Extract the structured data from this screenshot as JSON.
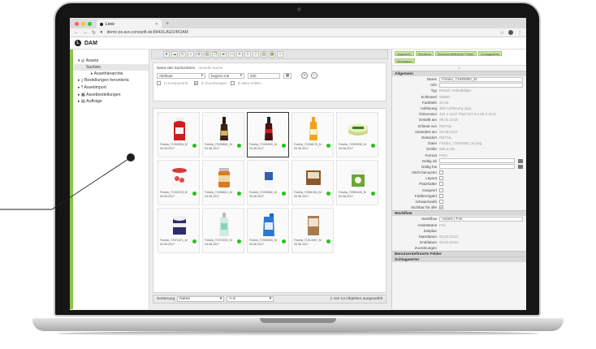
{
  "browser": {
    "tab_title": "Lexo",
    "url": "demo-px.avx.conosoft.de:8443/LAGO/ROAM",
    "window_dot_colors": [
      "#ff5f57",
      "#febc2e",
      "#28c840"
    ]
  },
  "app": {
    "title": "DAM"
  },
  "sidebar": {
    "items": [
      {
        "label": "Assets"
      },
      {
        "label": "Suchen"
      },
      {
        "label": "Assethierarchie"
      },
      {
        "label": "Bestellungen herunterla"
      },
      {
        "label": "Assetimport"
      },
      {
        "label": "Assetbestellungen"
      },
      {
        "label": "Aufträge"
      }
    ]
  },
  "search": {
    "label_name": "Name des Suchordners",
    "label_current": "Aktuelle Suche",
    "field_attr": "Attribute",
    "field_op": "beginnt mit",
    "field_value": "200",
    "chk_components": "In Komponenti...",
    "chk_assignments": "In Zuordnungen",
    "chk_all_articles": "In allen Artikel..."
  },
  "assets": [
    {
      "name": "Fotolia_71935906_M",
      "date": "03.08.2017",
      "kind": "ketchup"
    },
    {
      "name": "Fotolia_71939891_M",
      "date": "03.08.2017",
      "kind": "bottle-dark"
    },
    {
      "name": "Fotolia_71935950_M",
      "date": "03.08.2017",
      "kind": "cola"
    },
    {
      "name": "Fotolia_71938175_M",
      "date": "03.08.2017",
      "kind": "juice"
    },
    {
      "name": "Fotolia_71993935_M",
      "date": "03.08.2017",
      "kind": "tub"
    },
    {
      "name": "Fotolia_71933378_M",
      "date": "03.08.2017",
      "kind": "yogurt"
    },
    {
      "name": "Fotolia_71936610_M",
      "date": "03.08.2017",
      "kind": "jar"
    },
    {
      "name": "Fotolia_71939582_M",
      "date": "03.08.2017",
      "kind": "milk"
    },
    {
      "name": "Fotolia_72081304_M",
      "date": "03.08.2017",
      "kind": "box"
    },
    {
      "name": "Fotolia_72061628_M",
      "date": "03.08.2017",
      "kind": "carton"
    },
    {
      "name": "Fotolia_72071671_M",
      "date": "03.08.2017",
      "kind": "icecream"
    },
    {
      "name": "Fotolia_71974003_M",
      "date": "03.08.2017",
      "kind": "lotion"
    },
    {
      "name": "Fotolia_71935084_M",
      "date": "03.08.2017",
      "kind": "detergent"
    },
    {
      "name": "Fotolia_71914497_M",
      "date": "03.08.2017",
      "kind": "package"
    }
  ],
  "footer": {
    "sort_label": "Sortierung",
    "sort_field": "Name",
    "sort_order": "A-Z",
    "status": "1 von 14 Objekten ausgewählt"
  },
  "tags": [
    "Allgemein",
    "Workflow",
    "Benutzerdefinierte Felder",
    "Schlagwörter",
    "Metadaten"
  ],
  "props_header": "Allgemein",
  "props": [
    {
      "label": "Name",
      "value": "Fotolia_71935950_M",
      "input": true
    },
    {
      "label": "Info",
      "value": "",
      "input": true
    },
    {
      "label": "Typ",
      "value": "Retail / Artikelbilder"
    },
    {
      "label": "Schlüssel",
      "value": "63599"
    },
    {
      "label": "Farbtiefe",
      "value": "24 bit"
    },
    {
      "label": "Auflösung",
      "value": "300 Auflösung (dpi)"
    },
    {
      "label": "Dimension",
      "value": "441 x 1137 Pixel (37.8 x 96.3 mm)"
    },
    {
      "label": "Erstellt am",
      "value": "09.04.2015"
    },
    {
      "label": "Erfasst von",
      "value": "RETAIL"
    },
    {
      "label": "Geändert am",
      "value": "03.08.2017"
    },
    {
      "label": "Geändert",
      "value": "RETAIL"
    },
    {
      "label": "Datei",
      "value": "Fotolia_71935950_M.png"
    },
    {
      "label": "Größe",
      "value": "595,9 KB"
    },
    {
      "label": "Format",
      "value": "PNG"
    }
  ],
  "props_dates": [
    {
      "label": "Gültig ab"
    },
    {
      "label": "Gültig bis"
    }
  ],
  "props_checks": [
    {
      "label": "Nicht benutzen",
      "checked": false
    },
    {
      "label": "Layout",
      "checked": false
    },
    {
      "label": "Platzhalter",
      "checked": false
    },
    {
      "label": "Gesperrt",
      "checked": false
    },
    {
      "label": "Farbkorrigiert",
      "checked": false
    },
    {
      "label": "schwarzweiß",
      "checked": false
    },
    {
      "label": "Sichtbar für alle",
      "checked": true
    }
  ],
  "workflow_header": "Workflow",
  "workflow": [
    {
      "label": "Workflow",
      "value": "Assets | Foli",
      "input": true
    },
    {
      "label": "Assetstatus",
      "value": "Frei"
    },
    {
      "label": "Zeitplan",
      "value": ""
    },
    {
      "label": "Startdatum",
      "value": "03.02.2014"
    },
    {
      "label": "Enddatum",
      "value": "03.02.2014"
    },
    {
      "label": "Zuordnungen",
      "value": ""
    }
  ],
  "section_custom": "Benutzerdefinierte Felder",
  "section_keywords": "Schlagwörter"
}
